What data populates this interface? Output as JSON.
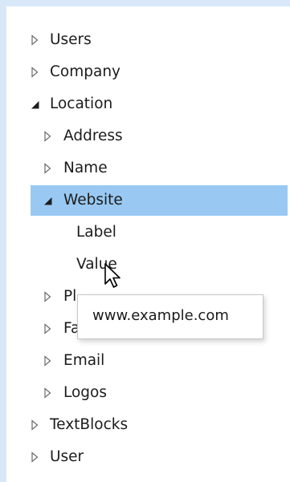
{
  "tree": {
    "items": [
      {
        "label": "Users",
        "state": "collapsed"
      },
      {
        "label": "Company",
        "state": "collapsed"
      },
      {
        "label": "Location",
        "state": "expanded"
      },
      {
        "label": "Address",
        "state": "collapsed"
      },
      {
        "label": "Name",
        "state": "collapsed"
      },
      {
        "label": "Website",
        "state": "expanded",
        "selected": true
      },
      {
        "label": "Label"
      },
      {
        "label": "Value"
      },
      {
        "label": "Pl",
        "state": "collapsed"
      },
      {
        "label": "Fa",
        "state": "collapsed"
      },
      {
        "label": "Email",
        "state": "collapsed"
      },
      {
        "label": "Logos",
        "state": "collapsed"
      },
      {
        "label": "TextBlocks",
        "state": "collapsed"
      },
      {
        "label": "User",
        "state": "collapsed"
      }
    ]
  },
  "tooltip": {
    "text": "www.example.com"
  },
  "icons": {
    "collapsed": "triangle-right-outline-icon",
    "expanded": "triangle-down-filled-icon",
    "cursor": "arrow-cursor-icon"
  },
  "colors": {
    "background": "#d9e8f9",
    "panel": "#ffffff",
    "selection": "#99c9f2",
    "text": "#1b1b1b",
    "tooltip_border": "#c8c8c8"
  }
}
